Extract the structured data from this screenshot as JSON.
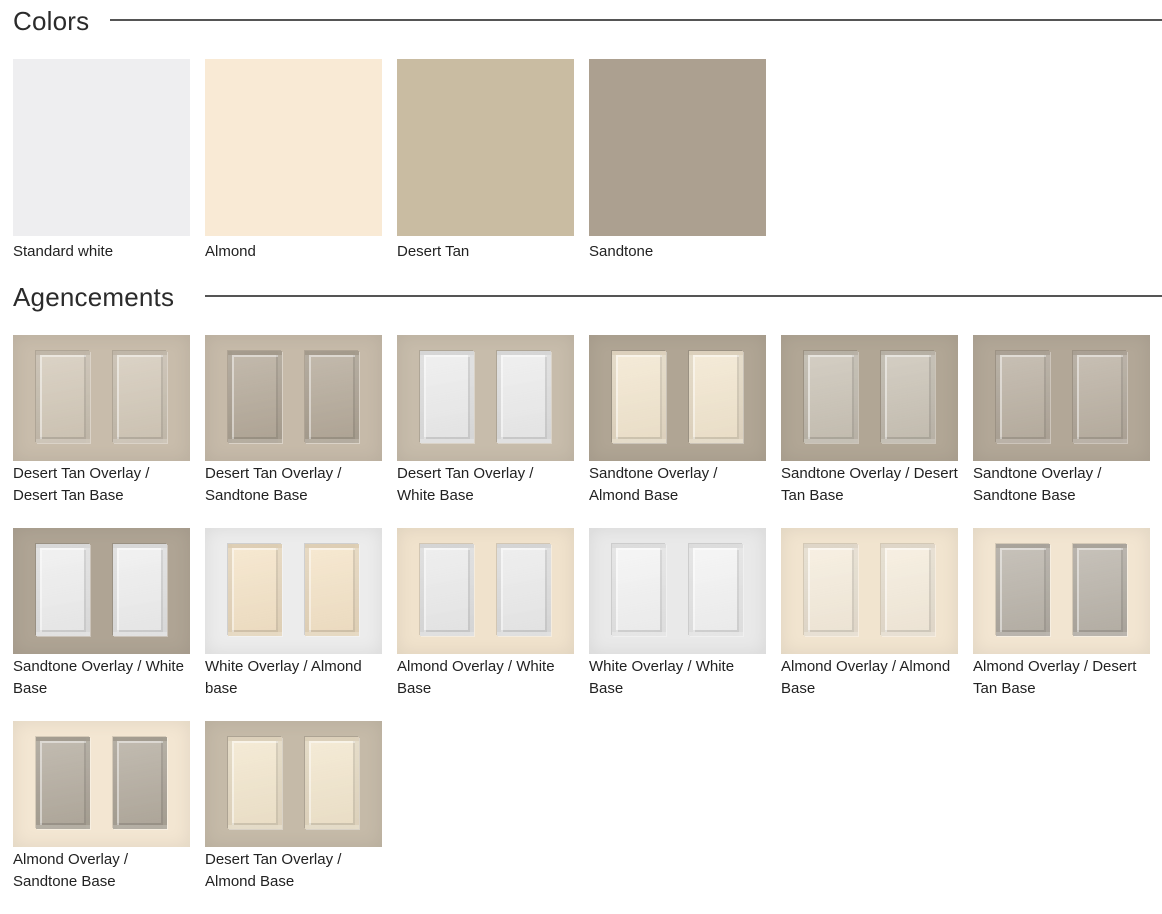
{
  "colors_section": {
    "title": "Colors",
    "swatches": [
      {
        "label": "Standard white",
        "color": "#eeeef0"
      },
      {
        "label": "Almond",
        "color": "#f9ead5"
      },
      {
        "label": "Desert Tan",
        "color": "#c9bca2"
      },
      {
        "label": "Sandtone",
        "color": "#aca090"
      }
    ]
  },
  "agencements_section": {
    "title": "Agencements",
    "combos": [
      {
        "label": "Desert Tan Overlay / Desert Tan Base",
        "overlay": "#c8bcab",
        "base": "#d3c9b9"
      },
      {
        "label": "Desert Tan Overlay / Sandtone Base",
        "overlay": "#c6baa9",
        "base": "#b5aa9a"
      },
      {
        "label": "Desert Tan Overlay / White Base",
        "overlay": "#c7bcab",
        "base": "#ececec"
      },
      {
        "label": "Sandtone Overlay / Almond Base",
        "overlay": "#b0a594",
        "base": "#f2e6cf"
      },
      {
        "label": "Sandtone Overlay / Desert Tan Base",
        "overlay": "#b1a695",
        "base": "#cac3b6"
      },
      {
        "label": "Sandtone Overlay / Sandtone Base",
        "overlay": "#b2a797",
        "base": "#bbb1a3"
      },
      {
        "label": "Sandtone Overlay / White Base",
        "overlay": "#afa494",
        "base": "#eeeeee"
      },
      {
        "label": "White Overlay / Almond base",
        "overlay": "#ececec",
        "base": "#f4e3c7"
      },
      {
        "label": "Almond Overlay / White Base",
        "overlay": "#f0e2cc",
        "base": "#ebebeb"
      },
      {
        "label": "White Overlay / White Base",
        "overlay": "#e9e9e9",
        "base": "#f3f3f3"
      },
      {
        "label": "Almond Overlay / Almond Base",
        "overlay": "#f1e4cf",
        "base": "#f5ecdc"
      },
      {
        "label": "Almond Overlay / Desert Tan Base",
        "overlay": "#f2e5d1",
        "base": "#bab4aa"
      },
      {
        "label": "Almond Overlay / Sandtone Base",
        "overlay": "#f3e6d2",
        "base": "#b4ac9f"
      },
      {
        "label": "Desert Tan Overlay / Almond Base",
        "overlay": "#c5baa8",
        "base": "#f2e6cd"
      }
    ]
  }
}
